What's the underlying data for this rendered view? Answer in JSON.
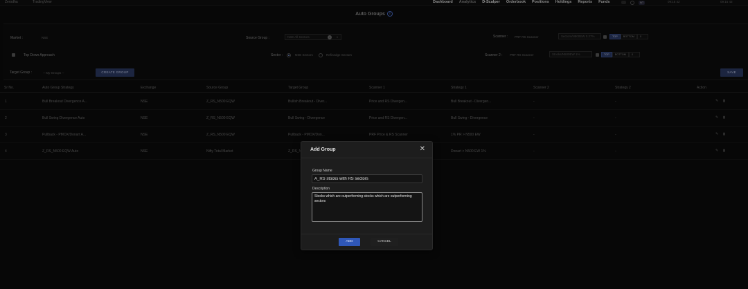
{
  "topbar": {
    "ext_left_1": "Zerodha",
    "ext_left_2": "TradingView",
    "nav": [
      "Dashboard",
      "Analytics",
      "D-Scalper",
      "Orderbook",
      "Positions",
      "Holdings",
      "Reports",
      "Funds"
    ],
    "active_nav": "Analytics",
    "badge": "NT",
    "time_1": "09:15 42",
    "time_2": "09:15 43"
  },
  "page": {
    "title": "Auto Groups"
  },
  "filters": {
    "market_label": "Market :",
    "market_value": "NSE",
    "source_group_label": "Source Group :",
    "source_group_value": "NSE All Sectors",
    "scanner_label": "Scanner :",
    "scanner_value": "PRF RS Scanner",
    "scanner_condition": "Sectors/N500EW 0.27%",
    "top_label": "TOP",
    "bottom_label": "BOTTOM",
    "count_1": "0",
    "top_down_label": "Top Down Approach",
    "sector_label": "Sector :",
    "sector_option_1": "NSE Sectors",
    "sector_option_2": "Refinedge Sectors",
    "scanner2_label": "Scanner 2 :",
    "scanner2_value": "PRF RS Scanner",
    "scanner2_condition": "Stocks/N500EW 1%",
    "count_2": "0",
    "target_group_label": "Target Group :",
    "target_group_value": "-- My Groups --",
    "create_group_label": "CREATE GROUP",
    "save_label": "SAVE"
  },
  "table": {
    "headers": [
      "Sr No.",
      "Auto Group Strategy",
      "Exchange",
      "Source Group",
      "Target Group",
      "Scanner 1",
      "Strategy 1",
      "Scanner 2",
      "Strategy 2",
      "Action"
    ],
    "rows": [
      {
        "sr": "1",
        "strategy": "Bull Breakout Divergence A...",
        "exchange": "NSE",
        "source": "Z_RS_N500 EQW",
        "target": "Bullish Breakout - Diver...",
        "scanner1": "Price and RS Divergen...",
        "strategy1": "Bull Breakout - Divergen...",
        "scanner2": "-",
        "strategy2": "-"
      },
      {
        "sr": "2",
        "strategy": "Bull Swing Divergence Auto",
        "exchange": "NSE",
        "source": "Z_RS_N500 EQW",
        "target": "Bull Swing - Divergence",
        "scanner1": "Price and RS Divergen...",
        "strategy1": "Bull Swing - Divergence",
        "scanner2": "-",
        "strategy2": "-"
      },
      {
        "sr": "3",
        "strategy": "Pullback - PMOX/Donart A...",
        "exchange": "NSE",
        "source": "Z_RS_N500 EQW",
        "target": "Pullback - PMOX/Don...",
        "scanner1": "PRF Price & RS Scanner",
        "strategy1": "1% PR > N500 EW",
        "scanner2": "-",
        "strategy2": "-"
      },
      {
        "sr": "4",
        "strategy": "Z_RS_N500 EQW Auto",
        "exchange": "NSE",
        "source": "Nifty Total Market",
        "target": "Z_RS_N5...",
        "scanner1": "",
        "strategy1": "Donart > N500 EW 1%",
        "scanner2": "-",
        "strategy2": "-"
      }
    ]
  },
  "modal": {
    "title": "Add Group",
    "group_name_label": "Group Name",
    "group_name_value": "A_RS stocks with RS sectors",
    "description_label": "Description",
    "description_value": "Stocks which are outperforming stocks which are outperforming sectors",
    "add_label": "ADD",
    "cancel_label": "CANCEL"
  },
  "icons": {
    "info": "info-icon",
    "close": "close-icon",
    "edit": "edit-icon",
    "delete": "trash-icon"
  }
}
